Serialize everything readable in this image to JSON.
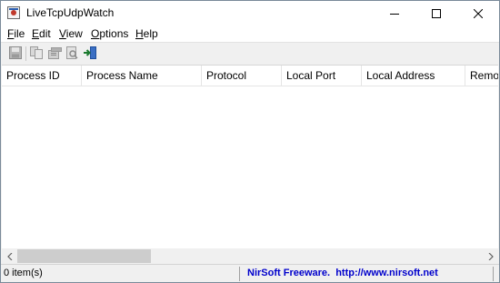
{
  "window": {
    "title": "LiveTcpUdpWatch"
  },
  "menu": [
    {
      "label": "File",
      "mnemonic": "F",
      "rest": "ile"
    },
    {
      "label": "Edit",
      "mnemonic": "E",
      "rest": "dit"
    },
    {
      "label": "View",
      "mnemonic": "V",
      "rest": "iew"
    },
    {
      "label": "Options",
      "mnemonic": "O",
      "rest": "ptions"
    },
    {
      "label": "Help",
      "mnemonic": "H",
      "rest": "elp"
    }
  ],
  "toolbar": {
    "icons": [
      "save-icon",
      "copy-icon",
      "properties-icon",
      "html-report-icon",
      "exit-icon"
    ]
  },
  "columns": [
    "Process ID",
    "Process Name",
    "Protocol",
    "Local Port",
    "Local Address",
    "Remot"
  ],
  "rows": [],
  "status": {
    "count": "0 item(s)",
    "link": "NirSoft Freeware.  http://www.nirsoft.net"
  },
  "colors": {
    "link": "#0000cc",
    "window_bg": "#f0f0f0"
  }
}
